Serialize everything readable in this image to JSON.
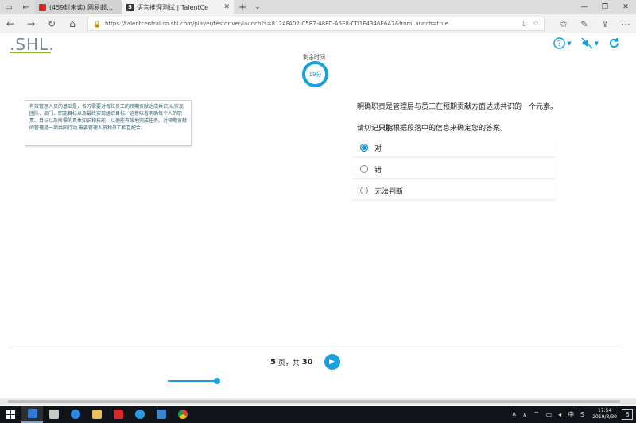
{
  "browser": {
    "tabs": [
      {
        "label": "(459封未读) 网易邮箱6.0版",
        "active": false
      },
      {
        "label": "语言推理测试 | TalentCe",
        "active": true
      }
    ],
    "new_tab_icon": "plus-icon",
    "url": "https://talentcentral.cn.shl.com/player/testdriver/launch?s=812AFA02-C587-48FD-A5E8-CD1E4346E6A7&fromLaunch=true"
  },
  "header": {
    "logo": ".SHL.",
    "help_icon": "question-circle-icon",
    "sound_icon": "mute-icon",
    "refresh_icon": "refresh-icon"
  },
  "timer": {
    "label": "剩余时间",
    "value": "19分"
  },
  "passage": {
    "text": "有效管理人员的基础是，各方需要对每位员工的预期贡献达成共识,以实现团队、部门、职能目标以及最终实现组织目标。这意味着明确每个人的职责、目标以及所需的具体知识和技能，以便能有效地完成任务。对预期贡献的管理是一项共同行动,需要管理人员和员工相互配合。"
  },
  "question": {
    "statement": "明确职责是管理层与员工在预期贡献方面达成共识的一个元素。",
    "instruction_before": "请切记",
    "instruction_bold": "只能",
    "instruction_after": "根据段落中的信息来确定您的答案。",
    "options": [
      {
        "label": "对",
        "selected": true
      },
      {
        "label": "错",
        "selected": false
      },
      {
        "label": "无法判断",
        "selected": false
      }
    ]
  },
  "footer": {
    "page_current": "5",
    "page_sep": " 页，共 ",
    "page_total": "30",
    "progress_fraction": 0.97
  },
  "taskbar": {
    "ime": "中",
    "sound": "S",
    "time": "17:54",
    "date": "2019/3/30",
    "notif_count": "6"
  },
  "colors": {
    "accent": "#1aa0e0",
    "shl_green": "#86bc25",
    "passage_text": "#2c5d6b"
  }
}
